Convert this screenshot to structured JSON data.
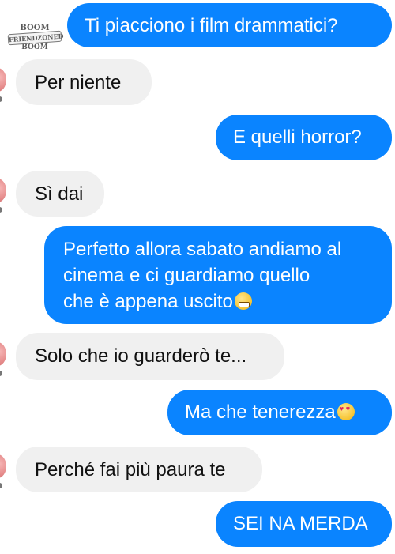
{
  "watermark": {
    "line1": "BOOM",
    "line2": "FRIENDZONED",
    "line3": "BOOM"
  },
  "messages": [
    {
      "from": "me",
      "text": "Ti piacciono i film drammatici?"
    },
    {
      "from": "them",
      "text": "Per niente"
    },
    {
      "from": "me",
      "text": "E quelli horror?"
    },
    {
      "from": "them",
      "text": "Sì dai"
    },
    {
      "from": "me",
      "lines": [
        "Perfetto allora sabato andiamo al",
        "cinema e ci guardiamo quello",
        "che è appena uscito"
      ],
      "emoji": "grinning-face-emoji"
    },
    {
      "from": "them",
      "text": "Solo che io guarderò te..."
    },
    {
      "from": "me",
      "text": "Ma che tenerezza",
      "emoji": "heart-eyes-emoji"
    },
    {
      "from": "them",
      "text": "Perché fai più paura te"
    },
    {
      "from": "me",
      "text": "SEI NA MERDA"
    }
  ],
  "colors": {
    "outgoing_bubble": "#0a84ff",
    "incoming_bubble": "#f0f0f0"
  }
}
